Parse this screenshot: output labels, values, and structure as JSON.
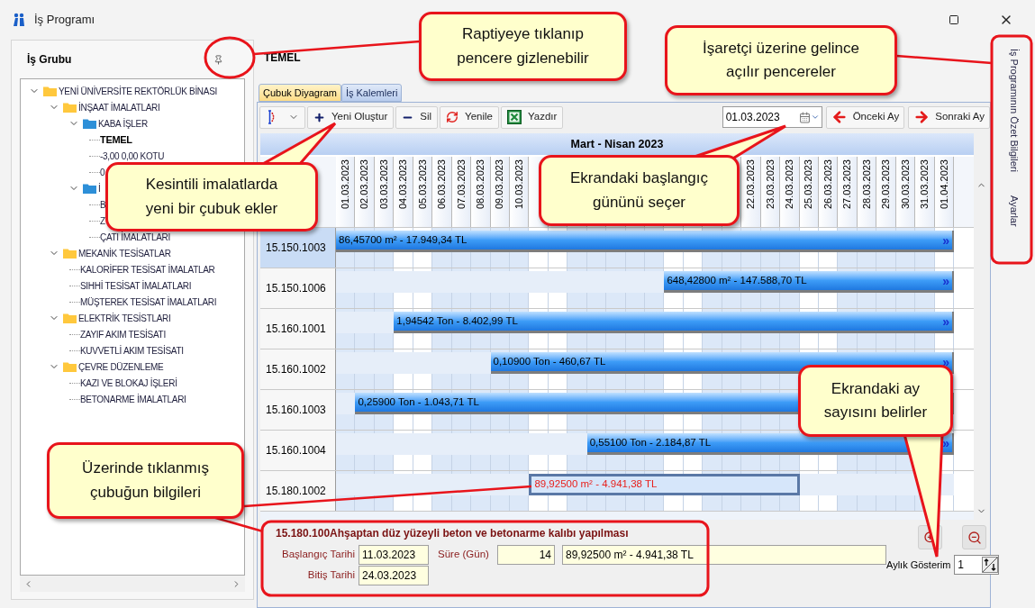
{
  "window": {
    "title": "İş Programı"
  },
  "left_panel": {
    "title": "İş Grubu",
    "tree": [
      {
        "kind": "folder",
        "label": "YENİ ÜNİVERSİTE REKTÖRLÜK BİNASI",
        "color": "#ffc83d",
        "expanded": true,
        "selected": false,
        "children": [
          {
            "kind": "folder",
            "label": "İNŞAAT İMALATLARI",
            "color": "#ffc83d",
            "expanded": true,
            "selected": false,
            "children": [
              {
                "kind": "folder",
                "label": "KABA İŞLER",
                "color": "#2d8fd8",
                "expanded": true,
                "selected": false,
                "children": [
                  {
                    "kind": "leaf",
                    "label": "TEMEL",
                    "selected": true
                  },
                  {
                    "kind": "leaf",
                    "label": "-3,00  0,00 KOTU",
                    "selected": false
                  },
                  {
                    "kind": "leaf",
                    "label": "0",
                    "selected": false
                  }
                ]
              },
              {
                "kind": "folder",
                "label": "İ",
                "color": "#2d8fd8",
                "expanded": true,
                "selected": false,
                "children": [
                  {
                    "kind": "leaf",
                    "label": "B",
                    "selected": false
                  },
                  {
                    "kind": "leaf",
                    "label": "Z",
                    "selected": false
                  },
                  {
                    "kind": "leaf",
                    "label": "ÇATI İMALATLARI",
                    "selected": false
                  }
                ]
              }
            ]
          },
          {
            "kind": "folder",
            "label": "MEKANİK TESİSATLAR",
            "color": "#ffc83d",
            "expanded": true,
            "selected": false,
            "children": [
              {
                "kind": "leaf",
                "label": "KALORİFER TESİSAT İMALATLAR",
                "selected": false
              },
              {
                "kind": "leaf",
                "label": "SIHHİ TESİSAT İMALATLARI",
                "selected": false
              },
              {
                "kind": "leaf",
                "label": "MÜŞTEREK TESİSAT İMALATLARI",
                "selected": false
              }
            ]
          },
          {
            "kind": "folder",
            "label": "ELEKTRİK TESİSTLARI",
            "color": "#ffc83d",
            "expanded": true,
            "selected": false,
            "children": [
              {
                "kind": "leaf",
                "label": "ZAYIF AKIM TESİSATI",
                "selected": false
              },
              {
                "kind": "leaf",
                "label": "KUVVETLİ AKIM TESİSATI",
                "selected": false
              }
            ]
          },
          {
            "kind": "folder",
            "label": "ÇEVRE DÜZENLEME",
            "color": "#ffc83d",
            "expanded": true,
            "selected": false,
            "children": [
              {
                "kind": "leaf",
                "label": "KAZI VE BLOKAJ İŞLERİ",
                "selected": false
              },
              {
                "kind": "leaf",
                "label": "BETONARME İMALATLARI",
                "selected": false
              }
            ]
          }
        ]
      }
    ]
  },
  "main": {
    "title": "TEMEL",
    "tabs": [
      {
        "label": "Çubuk Diyagram",
        "selected": true
      },
      {
        "label": "İş Kalemleri",
        "selected": false
      }
    ],
    "toolbar": [
      {
        "kind": "menu"
      },
      {
        "kind": "add",
        "label": "Yeni Oluştur"
      },
      {
        "kind": "delete",
        "label": "Sil"
      },
      {
        "kind": "refresh",
        "label": "Yenile"
      },
      {
        "kind": "print",
        "label": "Yazdır"
      }
    ],
    "date_field": {
      "value": "01.03.2023"
    },
    "nav": [
      {
        "kind": "prev",
        "label": "Önceki Ay"
      },
      {
        "kind": "next",
        "label": "Sonraki Ay"
      }
    ],
    "gantt": {
      "month_title": "Mart - Nisan 2023",
      "columns": [
        {
          "label": "01.03.2023",
          "weekend": false
        },
        {
          "label": "02.03.2023",
          "weekend": false
        },
        {
          "label": "03.03.2023",
          "weekend": false
        },
        {
          "label": "04.03.2023",
          "weekend": true
        },
        {
          "label": "05.03.2023",
          "weekend": true
        },
        {
          "label": "06.03.2023",
          "weekend": false
        },
        {
          "label": "07.03.2023",
          "weekend": false
        },
        {
          "label": "08.03.2023",
          "weekend": false
        },
        {
          "label": "09.03.2023",
          "weekend": false
        },
        {
          "label": "10.03.2023",
          "weekend": false
        },
        {
          "weekend": true
        },
        {
          "weekend": true
        },
        {
          "weekend": false
        },
        {
          "weekend": false
        },
        {
          "weekend": false
        },
        {
          "weekend": false
        },
        {
          "weekend": false
        },
        {
          "weekend": true
        },
        {
          "weekend": true
        },
        {
          "weekend": false
        },
        {
          "weekend": false
        },
        {
          "label": "22.03.2023",
          "weekend": false
        },
        {
          "label": "23.03.2023",
          "weekend": false
        },
        {
          "label": "24.03.2023",
          "weekend": false
        },
        {
          "label": "25.03.2023",
          "weekend": true
        },
        {
          "label": "26.03.2023",
          "weekend": true
        },
        {
          "label": "27.03.2023",
          "weekend": false
        },
        {
          "label": "28.03.2023",
          "weekend": false
        },
        {
          "label": "29.03.2023",
          "weekend": false
        },
        {
          "label": "30.03.2023",
          "weekend": false
        },
        {
          "label": "31.03.2023",
          "weekend": false
        },
        {
          "label": "01.04.2023",
          "weekend": true
        }
      ],
      "rows": [
        {
          "code": "15.150.1003",
          "selected": true,
          "bar": {
            "text": "86,45700 m² - 17.949,34 TL",
            "kind": "to_end",
            "level": 1,
            "more": "»",
            "selected": false
          }
        },
        {
          "code": "15.150.1006",
          "selected": false,
          "bar": {
            "text": "648,42800 m² - 147.588,70 TL",
            "kind": "to_end",
            "level": 0.46875,
            "more": "»",
            "selected": false
          }
        },
        {
          "code": "15.160.1001",
          "selected": false,
          "bar": {
            "text": "1,94542 Ton - 8.402,99 TL",
            "kind": "to_end",
            "level": 0.90625,
            "more": "»",
            "selected": false
          }
        },
        {
          "code": "15.160.1002",
          "selected": false,
          "bar": {
            "text": "0,10900 Ton - 460,67 TL",
            "kind": "to_end",
            "level": 0.75,
            "more": "»",
            "selected": false
          }
        },
        {
          "code": "15.160.1003",
          "selected": false,
          "bar": {
            "text": "0,25900 Ton - 1.043,71 TL",
            "kind": "to_end",
            "level": 0.96875,
            "selected": false
          }
        },
        {
          "code": "15.160.1004",
          "selected": false,
          "bar": {
            "text": "0,55100 Ton - 2.184,87 TL",
            "kind": "to_end",
            "level": 0.59375,
            "more": "»",
            "selected": false
          }
        },
        {
          "code": "15.180.1002",
          "selected": false,
          "bar": {
            "text": "89,92500 m² - 4.941,38 TL",
            "kind": "info_span",
            "selected": true
          }
        }
      ]
    },
    "info": {
      "title": "15.180.100Ahşaptan düz yüzeyli beton ve betonarme kalıbı yapılması",
      "start_label": "Başlangıç Tarihi",
      "start": "11.03.2023",
      "duration_label": "Süre (Gün)",
      "duration": "14",
      "amount": "89,92500 m² - 4.941,38 TL",
      "end_label": "Bitiş Tarihi",
      "end": "24.03.2023"
    },
    "monthly": {
      "label": "Aylık Gösterim",
      "value": "1"
    }
  },
  "side_tabs": [
    "İş Programının Özet Bilgileri",
    "Ayarlar"
  ],
  "callouts": [
    {
      "text": "Raptiyeye tıklanıp\npencere gizlenebilir"
    },
    {
      "text": "İşaretçi üzerine gelince\naçılır pencereler"
    },
    {
      "text": "Kesintili imalatlarda\nyeni bir çubuk ekler"
    },
    {
      "text": "Ekrandaki başlangıç\ngününü seçer"
    },
    {
      "text": "Ekrandaki ay\nsayısını belirler"
    },
    {
      "text": "Üzerinde tıklanmış\nçubuğun bilgileri"
    }
  ]
}
